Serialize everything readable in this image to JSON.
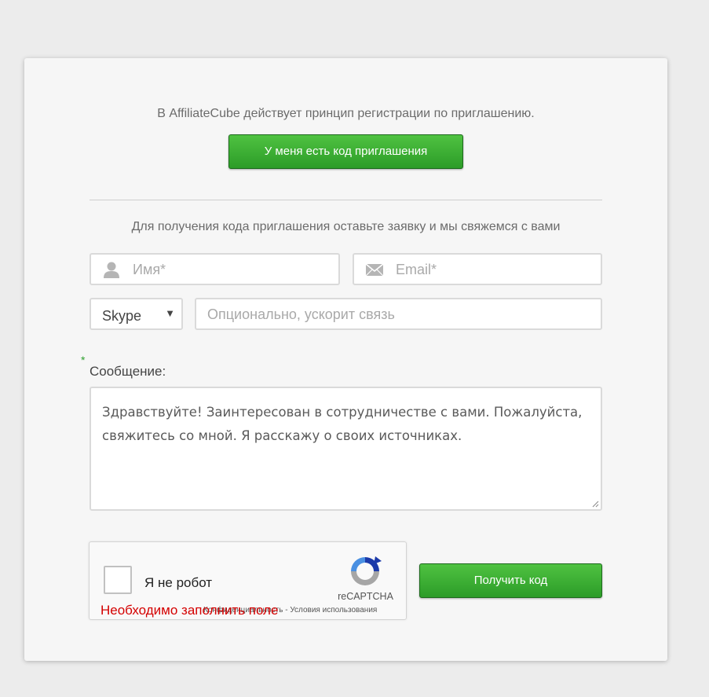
{
  "form": {
    "intro_text": "В AffiliateCube действует принцип регистрации по приглашению.",
    "invite_button": "У меня есть код приглашения",
    "subtitle": "Для получения кода приглашения оставьте заявку и мы свяжемся с вами",
    "name_placeholder": "Имя*",
    "email_placeholder": "Email*",
    "messenger_select": {
      "selected": "Skype"
    },
    "contact_placeholder": "Опционально, ускорит связь",
    "required_mark": "*",
    "message_label": "Сообщение:",
    "message_value": "Здравствуйте! Заинтересован в сотрудничестве с вами. Пожалуйста, свяжитесь со мной. Я расскажу о своих источниках.",
    "submit_button": "Получить код"
  },
  "captcha": {
    "label": "Я не робот",
    "brand": "reCAPTCHA",
    "links": "Конфиденциальность - Условия использования",
    "error": "Необходимо заполнить поле"
  },
  "colors": {
    "accent_green": "#2c9c28",
    "error_red": "#d40000",
    "background": "#ececec"
  },
  "icons": {
    "name_field": "user-icon",
    "email_field": "envelope-icon",
    "select": "triangle-down-icon",
    "captcha": "recaptcha-logo-icon"
  }
}
